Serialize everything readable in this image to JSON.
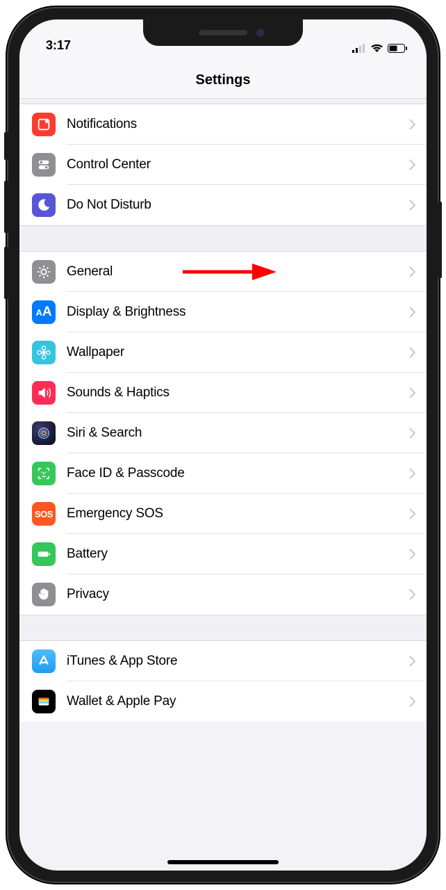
{
  "status": {
    "time": "3:17"
  },
  "header": {
    "title": "Settings"
  },
  "groups": [
    {
      "items": [
        {
          "id": "notifications",
          "label": "Notifications",
          "icon": "notifications-icon",
          "bg": "#ff3b30"
        },
        {
          "id": "control-center",
          "label": "Control Center",
          "icon": "toggles-icon",
          "bg": "#8e8e93"
        },
        {
          "id": "do-not-disturb",
          "label": "Do Not Disturb",
          "icon": "moon-icon",
          "bg": "#5856d6"
        }
      ]
    },
    {
      "items": [
        {
          "id": "general",
          "label": "General",
          "icon": "gear-icon",
          "bg": "#8e8e93",
          "annotated": true
        },
        {
          "id": "display-brightness",
          "label": "Display & Brightness",
          "icon": "text-size-icon",
          "bg": "#007aff"
        },
        {
          "id": "wallpaper",
          "label": "Wallpaper",
          "icon": "flower-icon",
          "bg": "#37c2e0"
        },
        {
          "id": "sounds-haptics",
          "label": "Sounds & Haptics",
          "icon": "speaker-icon",
          "bg": "#ff2d55"
        },
        {
          "id": "siri-search",
          "label": "Siri & Search",
          "icon": "siri-icon",
          "bg": "#000000"
        },
        {
          "id": "face-id-passcode",
          "label": "Face ID & Passcode",
          "icon": "faceid-icon",
          "bg": "#34c759"
        },
        {
          "id": "emergency-sos",
          "label": "Emergency SOS",
          "icon": "sos-icon",
          "bg": "#ff5722"
        },
        {
          "id": "battery",
          "label": "Battery",
          "icon": "battery-icon",
          "bg": "#34c759"
        },
        {
          "id": "privacy",
          "label": "Privacy",
          "icon": "hand-icon",
          "bg": "#8e8e93"
        }
      ]
    },
    {
      "items": [
        {
          "id": "itunes-app-store",
          "label": "iTunes & App Store",
          "icon": "appstore-icon",
          "bg": "#1f9cf0"
        },
        {
          "id": "wallet-apple-pay",
          "label": "Wallet & Apple Pay",
          "icon": "wallet-icon",
          "bg": "#000000"
        }
      ]
    }
  ]
}
